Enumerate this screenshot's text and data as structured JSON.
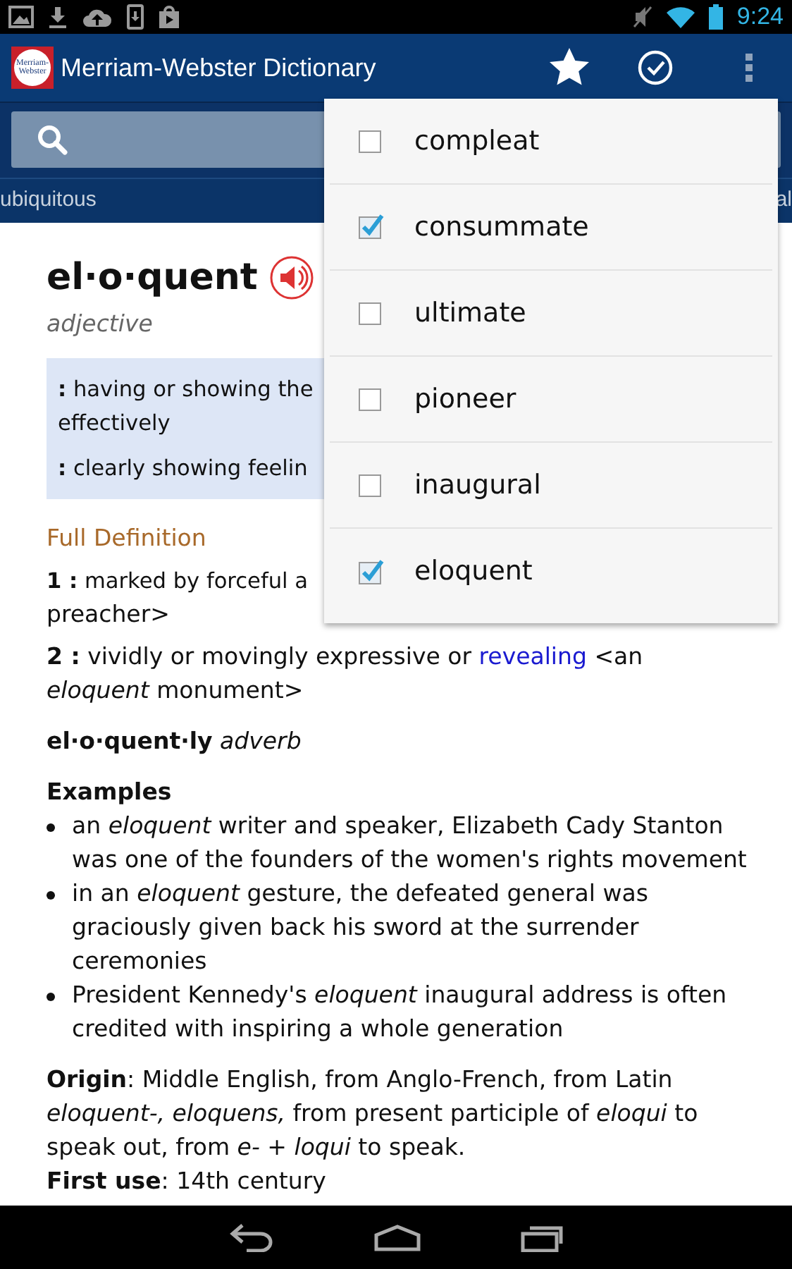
{
  "status_bar": {
    "time": "9:24"
  },
  "app_bar": {
    "title": "Merriam-Webster Dictionary",
    "logo_lines": [
      "Merriam-",
      "Webster"
    ]
  },
  "word_strip": [
    {
      "label": "ubiquitous"
    },
    {
      "label": "al"
    }
  ],
  "entry": {
    "headword": "el·o·quent",
    "part_of_speech": "adjective",
    "short_defs": [
      {
        "lines": [
          "**:** having or showing the",
          "effectively"
        ]
      },
      {
        "lines": [
          "**:** clearly showing feelin"
        ]
      }
    ],
    "full_definition_label": "Full Definition",
    "senses": [
      {
        "lines": [
          "**1 :** marked by forceful a",
          "preacher>"
        ]
      },
      {
        "before": "**2 :** vividly or movingly expressive or ",
        "link": "revealing",
        "after": " <an *eloquent* monument>"
      }
    ],
    "run_on": "**el·o·quent·ly** *adverb*",
    "examples_label": "Examples",
    "examples": [
      "an *eloquent* writer and speaker, Elizabeth Cady Stanton was one of the founders of the women's rights movement",
      "in an *eloquent* gesture, the defeated general was graciously given back his sword at the surrender ceremonies",
      "President Kennedy's *eloquent* inaugural address is often credited with inspiring a whole generation"
    ],
    "origin": "**Origin**: Middle English, from Anglo-French, from Latin *eloquent-, eloquens,* from present participle of *eloqui* to speak out, from *e-* + *loqui* to speak.",
    "first_use": "**First use**: 14th century"
  },
  "menu": [
    {
      "label": "compleat",
      "checked": false
    },
    {
      "label": "consummate",
      "checked": true
    },
    {
      "label": "ultimate",
      "checked": false
    },
    {
      "label": "pioneer",
      "checked": false
    },
    {
      "label": "inaugural",
      "checked": false
    },
    {
      "label": "eloquent",
      "checked": true
    }
  ]
}
